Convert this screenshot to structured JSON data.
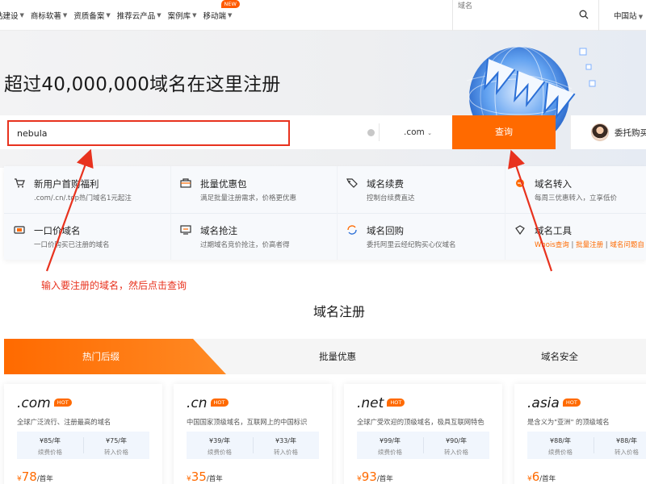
{
  "nav": {
    "items": [
      {
        "label": "站建设"
      },
      {
        "label": "商标软著"
      },
      {
        "label": "资质备案"
      },
      {
        "label": "推荐云产品"
      },
      {
        "label": "案例库"
      },
      {
        "label": "移动端",
        "badge": "NEW"
      }
    ],
    "search_placeholder": "域名",
    "region": "中国站"
  },
  "hero": {
    "title": "超过40,000,000域名在这里注册"
  },
  "search": {
    "value": "nebula",
    "suffix": ".com",
    "button": "查询",
    "agent": "委托购买"
  },
  "services": [
    {
      "title": "新用户首购福利",
      "desc": ".com/.cn/.top热门域名1元起注",
      "icon": "cart-icon"
    },
    {
      "title": "批量优惠包",
      "desc": "满足批量注册需求，价格更优惠",
      "icon": "package-icon"
    },
    {
      "title": "域名续费",
      "desc": "控制台续费直达",
      "icon": "tag-icon"
    },
    {
      "title": "域名转入",
      "desc": "每周三优惠转入，立享低价",
      "icon": "transfer-icon"
    },
    {
      "title": "一口价域名",
      "desc": "一口价购买已注册的域名",
      "icon": "price-tag-icon"
    },
    {
      "title": "域名抢注",
      "desc": "过期域名竞价抢注，价高者得",
      "icon": "monitor-icon"
    },
    {
      "title": "域名回购",
      "desc": "委托阿里云经纪购买心仪域名",
      "icon": "refresh-icon"
    },
    {
      "title": "域名工具",
      "desc_links": [
        "Whois查询",
        "批量注册",
        "域名问题自"
      ],
      "icon": "tool-icon"
    }
  ],
  "annotation": "输入要注册的域名，然后点击查询",
  "section": {
    "title": "域名注册",
    "tabs": [
      "热门后缀",
      "批量优惠",
      "域名安全"
    ]
  },
  "cards": [
    {
      "suffix": ".com",
      "hot": "HOT",
      "desc": "全球广泛流行、注册最高的域名",
      "renew": "¥85/年",
      "renew_label": "续费价格",
      "transfer": "¥75/年",
      "transfer_label": "转入价格",
      "price": "78",
      "unit": "/首年"
    },
    {
      "suffix": ".cn",
      "hot": "HOT",
      "desc": "中国国家顶级域名，互联网上的中国标识",
      "renew": "¥39/年",
      "renew_label": "续费价格",
      "transfer": "¥33/年",
      "transfer_label": "转入价格",
      "price": "35",
      "unit": "/首年"
    },
    {
      "suffix": ".net",
      "hot": "HOT",
      "desc": "全球广受欢迎的顶级域名，极具互联网特色",
      "renew": "¥99/年",
      "renew_label": "续费价格",
      "transfer": "¥90/年",
      "transfer_label": "转入价格",
      "price": "93",
      "unit": "/首年"
    },
    {
      "suffix": ".asia",
      "hot": "HOT",
      "desc": "是含义为\"亚洲\" 的顶级域名",
      "renew": "¥88/年",
      "renew_label": "续费价格",
      "transfer": "¥88/年",
      "transfer_label": "转入价格",
      "price": "6",
      "unit": "/首年"
    }
  ],
  "colors": {
    "accent": "#ff6a00",
    "annotation": "#e8321e"
  }
}
